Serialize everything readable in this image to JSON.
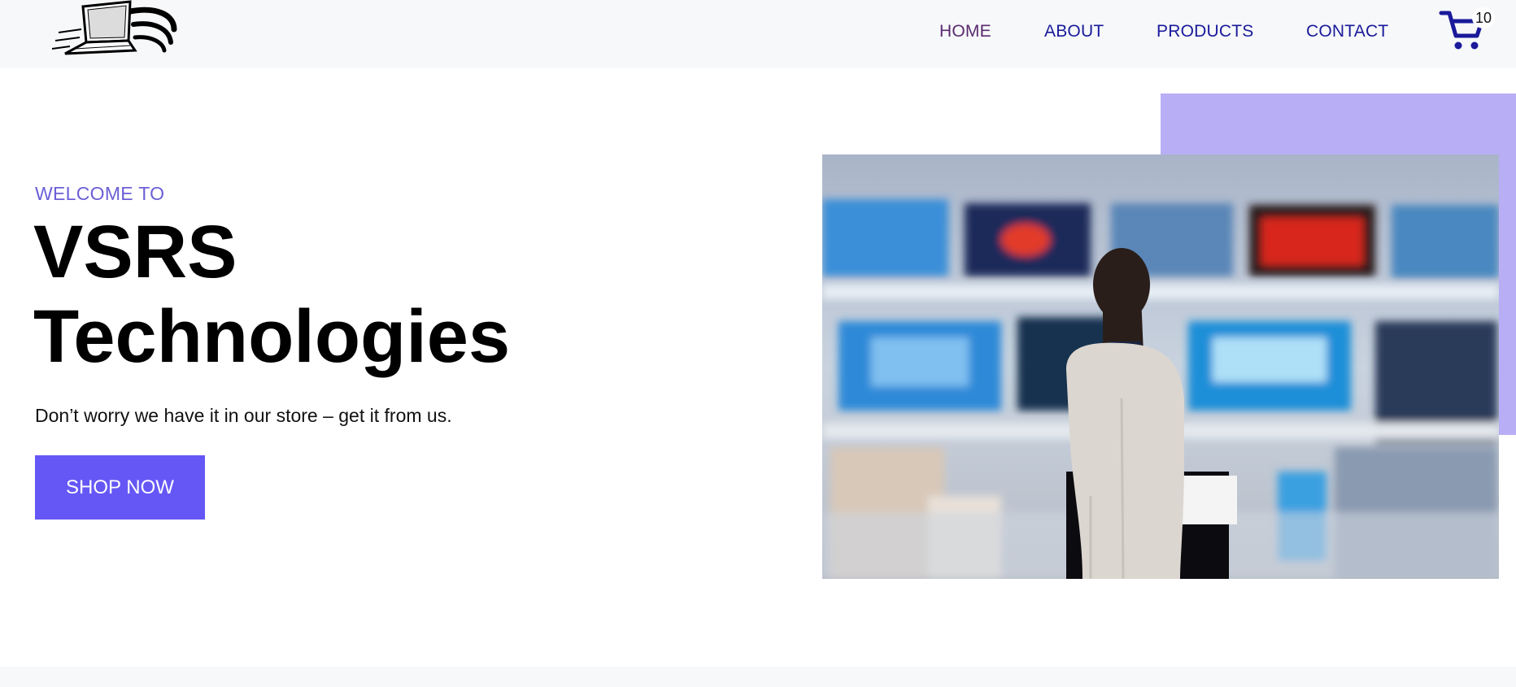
{
  "nav": {
    "logo_alt": "VSRS Technologies logo",
    "links": [
      {
        "label": "HOME",
        "active": true
      },
      {
        "label": "ABOUT",
        "active": false
      },
      {
        "label": "PRODUCTS",
        "active": false
      },
      {
        "label": "CONTACT",
        "active": false
      }
    ],
    "cart": {
      "icon": "cart-icon",
      "count": "10"
    }
  },
  "hero": {
    "welcome": "WELCOME TO",
    "brand_line1": "VSRS",
    "brand_line2": "Technologies",
    "tagline": "Don’t worry we have it in our store – get it from us.",
    "cta_label": "SHOP NOW",
    "image_alt": "Woman browsing televisions in an electronics store"
  },
  "colors": {
    "nav_background": "#f6f8fa",
    "nav_link": "#1a1a9a",
    "nav_link_active": "#5a2a6e",
    "accent": "#6557f5",
    "accent_light": "#b8aef5",
    "welcome_text": "#6b5fd6"
  }
}
